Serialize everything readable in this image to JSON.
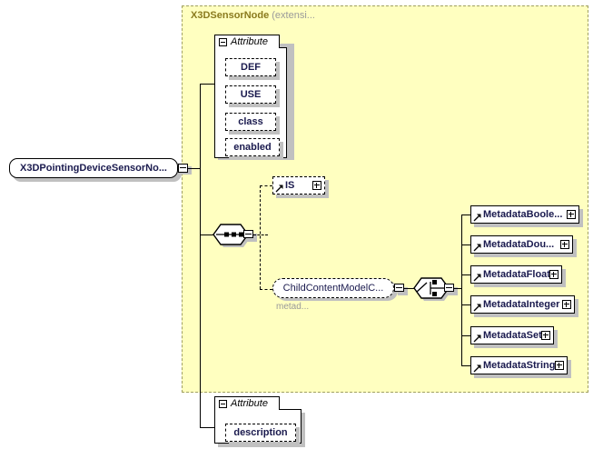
{
  "diagram": {
    "type": "xml-schema-diagram",
    "root_element": {
      "label": "X3DPointingDeviceSensorNo...",
      "collapse_icon": "minus-box"
    },
    "extension_region": {
      "title": "X3DSensorNode",
      "subtitle": "(extensi...",
      "background_color": "#ffffc0",
      "border_color": "#a0a060"
    },
    "attribute_group_top": {
      "label": "Attribute",
      "collapse_icon": "minus-box",
      "attributes": [
        {
          "name": "DEF"
        },
        {
          "name": "USE"
        },
        {
          "name": "class"
        },
        {
          "name": "enabled"
        }
      ]
    },
    "attribute_group_bottom": {
      "label": "Attribute",
      "collapse_icon": "minus-box",
      "attributes": [
        {
          "name": "description"
        }
      ]
    },
    "sequence_compositor": {
      "kind": "sequence",
      "collapse_icon": "minus-box"
    },
    "choice_compositor": {
      "kind": "choice",
      "collapse_icon": "minus-box"
    },
    "child_nodes": [
      {
        "label": "IS",
        "expand_icon": "plus-box",
        "style": "dashed"
      },
      {
        "label": "ChildContentModelC...",
        "sub_label": "metad...",
        "expand_icon": "minus-box",
        "style": "dashed-rounded"
      }
    ],
    "metadata_nodes": [
      {
        "label": "MetadataBoole...",
        "expand_icon": "plus-box",
        "width": 120
      },
      {
        "label": "MetadataDou...",
        "expand_icon": "plus-box",
        "width": 113
      },
      {
        "label": "MetadataFloat",
        "expand_icon": "plus-box",
        "width": 101
      },
      {
        "label": "MetadataInteger",
        "expand_icon": "plus-box",
        "width": 115
      },
      {
        "label": "MetadataSet",
        "expand_icon": "plus-box",
        "width": 92
      },
      {
        "label": "MetadataString",
        "expand_icon": "plus-box",
        "width": 107
      }
    ],
    "colors": {
      "node_text": "#1a1a4e",
      "region_fill": "#ffffc0",
      "region_border": "#a0a060",
      "shadow": "#c0c0c0",
      "title_text": "#8a7a1e",
      "muted_text": "#9a9a9a"
    }
  }
}
